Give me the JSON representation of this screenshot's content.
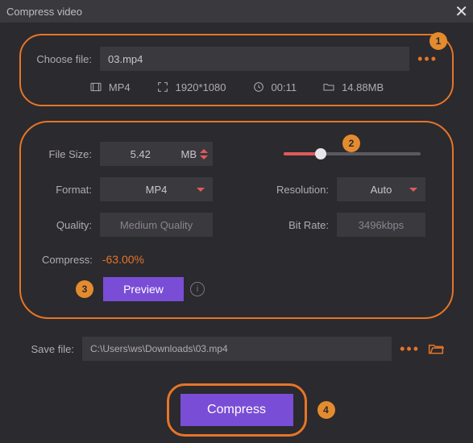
{
  "window": {
    "title": "Compress video",
    "close": "✕"
  },
  "choose": {
    "label": "Choose file:",
    "filename": "03.mp4",
    "dots": "•••",
    "meta": {
      "format": "MP4",
      "resolution": "1920*1080",
      "duration": "00:11",
      "size": "14.88MB"
    }
  },
  "settings": {
    "filesize": {
      "label": "File Size:",
      "value": "5.42",
      "unit": "MB"
    },
    "format": {
      "label": "Format:",
      "value": "MP4"
    },
    "quality": {
      "label": "Quality:",
      "value": "Medium Quality"
    },
    "resolution": {
      "label": "Resolution:",
      "value": "Auto"
    },
    "bitrate": {
      "label": "Bit Rate:",
      "value": "3496kbps"
    },
    "compress": {
      "label": "Compress:",
      "value": "-63.00%"
    },
    "preview": "Preview",
    "info": "i"
  },
  "save": {
    "label": "Save file:",
    "path": "C:\\Users\\ws\\Downloads\\03.mp4",
    "dots": "•••"
  },
  "action": {
    "compress": "Compress"
  },
  "badges": {
    "b1": "1",
    "b2": "2",
    "b3": "3",
    "b4": "4"
  }
}
